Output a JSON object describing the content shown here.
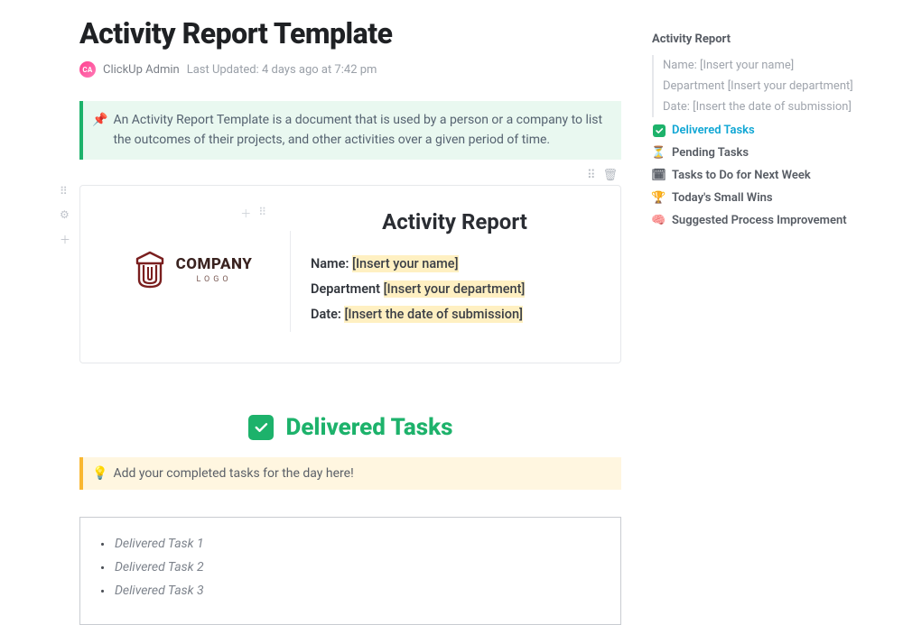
{
  "page": {
    "title": "Activity Report Template",
    "author": "ClickUp Admin",
    "avatar_initials": "CA",
    "updated_prefix": "Last Updated:",
    "updated_value": "4 days ago at 7:42 pm"
  },
  "callout_intro": {
    "icon": "📌",
    "text": "An Activity Report Template is a document that is used by a person or a company to list the outcomes of their projects, and other activities over a given period of time."
  },
  "report": {
    "logo": {
      "top": "COMPANY",
      "bottom": "LOGO"
    },
    "title": "Activity Report",
    "fields": {
      "name_label": "Name:",
      "name_placeholder": "[Insert your name]",
      "dept_label": "Department",
      "dept_placeholder": "[Insert your department]",
      "date_label": "Date:",
      "date_placeholder": "[Insert the date of submission]"
    }
  },
  "delivered": {
    "heading": "Delivered Tasks",
    "callout_icon": "💡",
    "callout_text": "Add your completed tasks for the day here!",
    "items": [
      "Delivered Task 1",
      "Delivered Task 2",
      "Delivered Task 3"
    ]
  },
  "outline": {
    "title": "Activity Report",
    "subs": [
      "Name: [Insert your name]",
      "Department [Insert your department]",
      "Date: [Insert the date of submission]"
    ],
    "items": [
      {
        "icon": "check",
        "label": "Delivered Tasks",
        "active": true
      },
      {
        "icon": "⏳",
        "label": "Pending Tasks"
      },
      {
        "icon": "🗓",
        "label": "Tasks to Do for Next Week"
      },
      {
        "icon": "🏆",
        "label": "Today's Small Wins"
      },
      {
        "icon": "🧠",
        "label": "Suggested Process Improvement"
      }
    ]
  }
}
